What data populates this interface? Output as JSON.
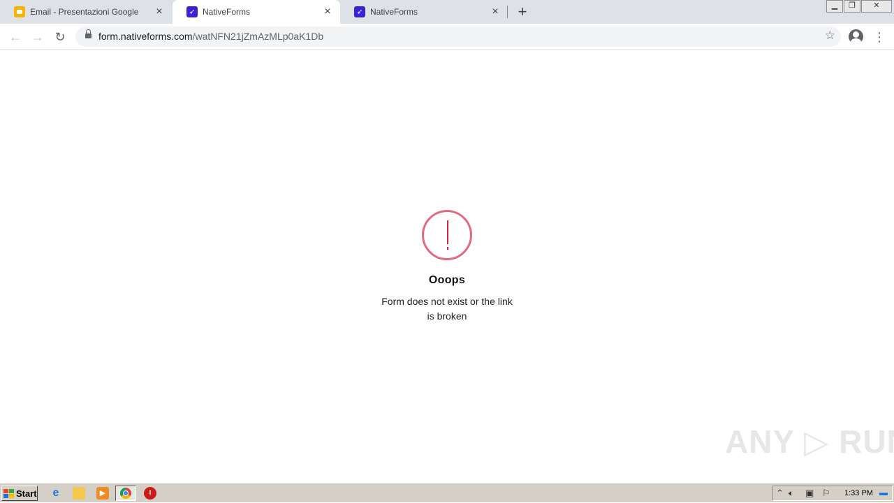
{
  "tabs": [
    {
      "title": "Email - Presentazioni Google",
      "icon": "google-slides-icon",
      "active": false
    },
    {
      "title": "NativeForms",
      "icon": "nativeforms-icon",
      "active": true
    },
    {
      "title": "NativeForms",
      "icon": "nativeforms-icon",
      "active": false
    }
  ],
  "new_tab_label": "+",
  "toolbar": {
    "url_host": "form.nativeforms.com",
    "url_path": "/watNFN21jZmAzMLp0aK1Db"
  },
  "error": {
    "title": "Ooops",
    "message_line1": "Form does not exist or the link",
    "message_line2": "is broken"
  },
  "watermark": "ANY ▷ RUN",
  "taskbar": {
    "start_label": "Start",
    "clock": "1:33 PM"
  },
  "colors": {
    "error_ring": "#e26b80",
    "error_mark": "#d81f4a",
    "nativeforms_brand": "#3d1fd6",
    "slides_brand": "#f4b400"
  }
}
